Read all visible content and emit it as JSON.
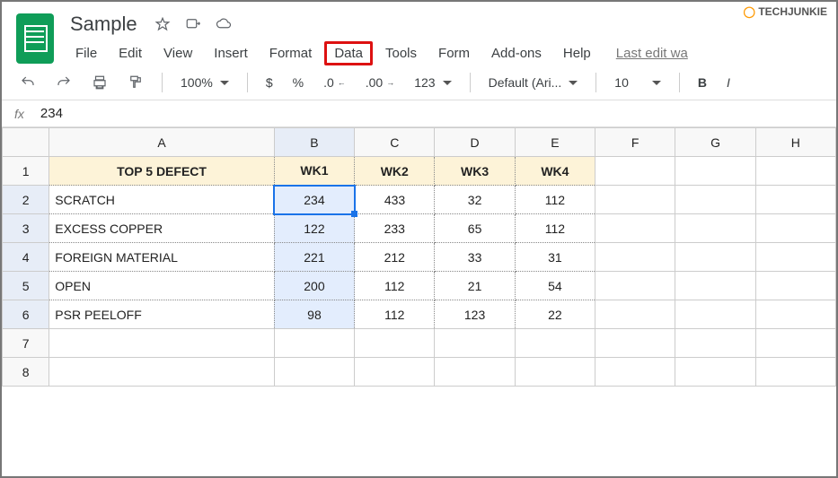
{
  "watermark": "TECHJUNKIE",
  "doc": {
    "name": "Sample"
  },
  "menu": {
    "file": "File",
    "edit": "Edit",
    "view": "View",
    "insert": "Insert",
    "format": "Format",
    "data": "Data",
    "tools": "Tools",
    "form": "Form",
    "addons": "Add-ons",
    "help": "Help",
    "last_edit": "Last edit wa"
  },
  "toolbar": {
    "zoom": "100%",
    "currency": "$",
    "percent": "%",
    "dec_less": ".0",
    "dec_more": ".00",
    "num": "123",
    "font": "Default (Ari...",
    "size": "10",
    "bold": "B",
    "italic": "I"
  },
  "formula": {
    "label": "fx",
    "value": "234"
  },
  "chart_data": {
    "type": "table",
    "title": "TOP 5 DEFECT",
    "columns": [
      "WK1",
      "WK2",
      "WK3",
      "WK4"
    ],
    "rows": [
      {
        "label": "SCRATCH",
        "values": [
          234,
          433,
          32,
          112
        ]
      },
      {
        "label": "EXCESS COPPER",
        "values": [
          122,
          233,
          65,
          112
        ]
      },
      {
        "label": "FOREIGN MATERIAL",
        "values": [
          221,
          212,
          33,
          31
        ]
      },
      {
        "label": "OPEN",
        "values": [
          200,
          112,
          21,
          54
        ]
      },
      {
        "label": "PSR PEELOFF",
        "values": [
          98,
          112,
          123,
          22
        ]
      }
    ]
  },
  "cols": [
    "A",
    "B",
    "C",
    "D",
    "E",
    "F",
    "G",
    "H"
  ],
  "rownums": [
    "1",
    "2",
    "3",
    "4",
    "5",
    "6",
    "7",
    "8"
  ]
}
